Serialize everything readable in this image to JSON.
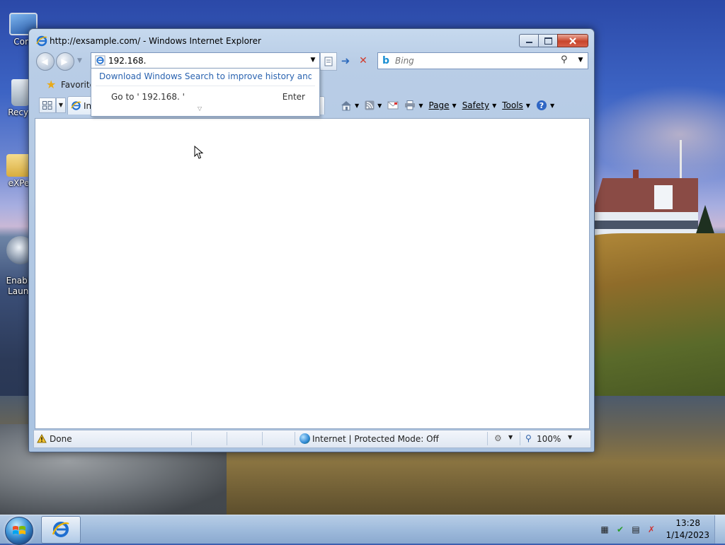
{
  "desktop": {
    "icons": [
      {
        "label": "Com"
      },
      {
        "label": "Recyc"
      },
      {
        "label": "eXPer"
      },
      {
        "label": "Enable\nLaunc"
      }
    ]
  },
  "window": {
    "title": "http://exsample.com/ - Windows Internet Explorer",
    "address_value": "192.168.",
    "search_placeholder": "Bing",
    "favorites_label": "Favorite",
    "tab_label": "Int",
    "commands": {
      "page": "Page",
      "safety": "Safety",
      "tools": "Tools"
    },
    "autocomplete": {
      "link": "Download Windows Search to improve history and fa...",
      "goto": "Go to ' 192.168. '",
      "enter": "Enter"
    },
    "status": {
      "text": "Done",
      "zone": "Internet | Protected Mode: Off",
      "zoom": "100%"
    }
  },
  "taskbar": {
    "time": "13:28",
    "date": "1/14/2023"
  },
  "colors": {
    "accent": "#2a63b0",
    "close_button": "#c8452c",
    "taskbar": "#9fbbdc"
  }
}
